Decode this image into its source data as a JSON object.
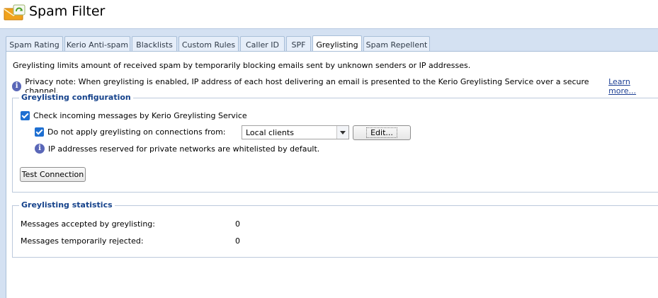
{
  "app": {
    "title": "Spam Filter",
    "icon": "envelope-with-recycle-icon"
  },
  "tabs": [
    {
      "label": "Spam Rating",
      "active": false
    },
    {
      "label": "Kerio Anti-spam",
      "active": false
    },
    {
      "label": "Blacklists",
      "active": false
    },
    {
      "label": "Custom Rules",
      "active": false
    },
    {
      "label": "Caller ID",
      "active": false
    },
    {
      "label": "SPF",
      "active": false
    },
    {
      "label": "Greylisting",
      "active": true
    },
    {
      "label": "Spam Repellent",
      "active": false
    }
  ],
  "intro": "Greylisting limits amount of received spam by temporarily blocking emails sent by unknown senders or IP addresses.",
  "privacy": {
    "text": "Privacy note: When greylisting is enabled, IP address of each host delivering an email is presented to the Kerio Greylisting Service over a secure channel.",
    "link": "Learn more..."
  },
  "config": {
    "legend": "Greylisting configuration",
    "check_incoming": {
      "label": "Check incoming messages by Kerio Greylisting Service",
      "checked": true
    },
    "do_not_apply": {
      "label": "Do not apply greylisting on connections from:",
      "checked": true
    },
    "select_value": "Local clients",
    "edit_label": "Edit...",
    "note": "IP addresses reserved for private networks are whitelisted by default.",
    "test_label": "Test Connection"
  },
  "stats": {
    "legend": "Greylisting statistics",
    "accepted_label": "Messages accepted by greylisting:",
    "accepted_value": "0",
    "rejected_label": "Messages temporarily rejected:",
    "rejected_value": "0"
  },
  "colors": {
    "tabstrip": "#d4e1f2",
    "legend_text": "#15428b",
    "link": "#1c3f94",
    "checkbox": "#1e6fd1"
  }
}
